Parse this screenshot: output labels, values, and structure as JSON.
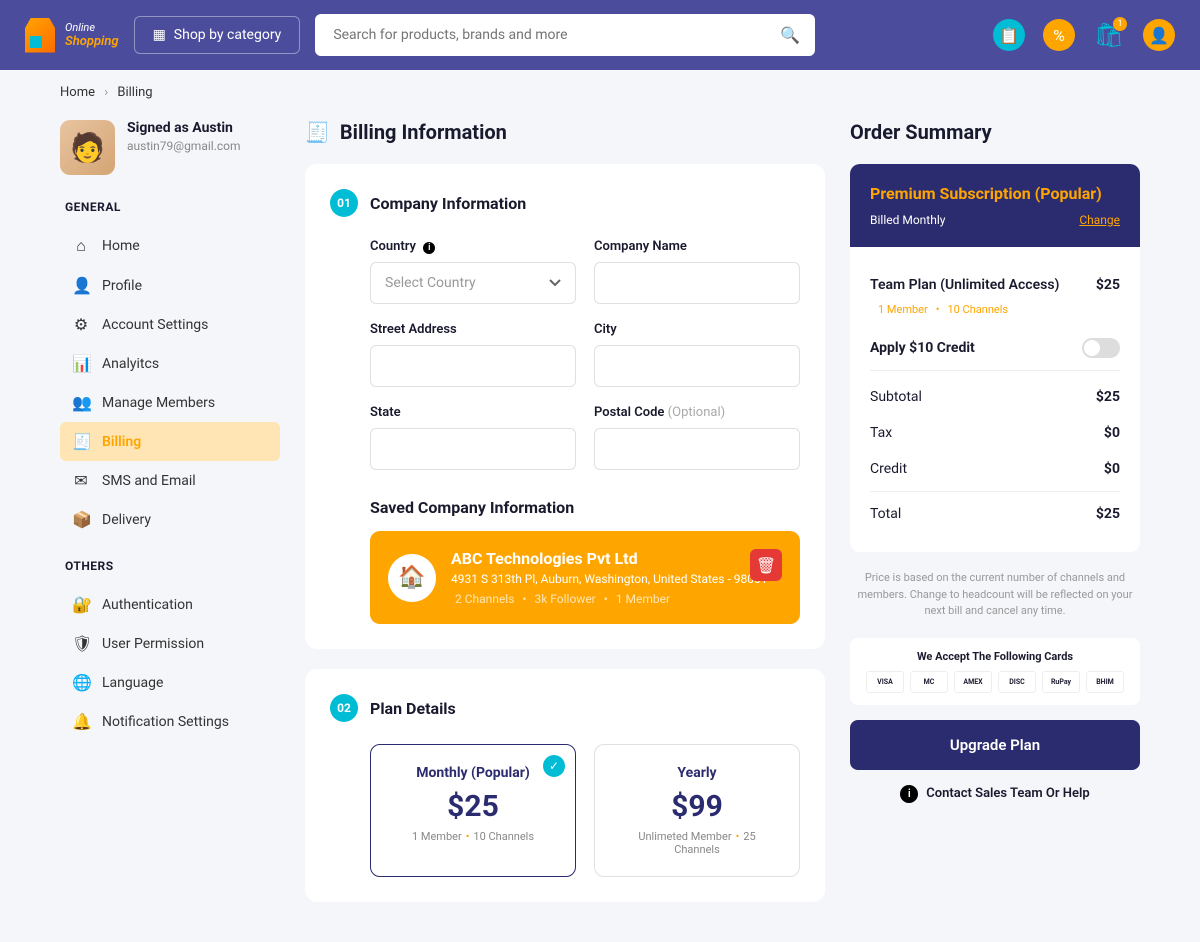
{
  "header": {
    "logo_line1": "Online",
    "logo_line2": "Shopping",
    "category_btn": "Shop by category",
    "search_placeholder": "Search for products, brands and more",
    "cart_badge": "1"
  },
  "breadcrumb": {
    "home": "Home",
    "current": "Billing"
  },
  "user": {
    "signed_as": "Signed as Austin",
    "email": "austin79@gmail.com"
  },
  "sidebar": {
    "groups": [
      {
        "title": "GENERAL",
        "items": [
          {
            "label": "Home",
            "icon": "⌂"
          },
          {
            "label": "Profile",
            "icon": "👤"
          },
          {
            "label": "Account Settings",
            "icon": "⚙"
          },
          {
            "label": "Analyitcs",
            "icon": "📊"
          },
          {
            "label": "Manage Members",
            "icon": "👥"
          },
          {
            "label": "Billing",
            "icon": "🧾",
            "active": true
          },
          {
            "label": "SMS and Email",
            "icon": "✉"
          },
          {
            "label": "Delivery",
            "icon": "📦"
          }
        ]
      },
      {
        "title": "OTHERS",
        "items": [
          {
            "label": "Authentication",
            "icon": "🔐"
          },
          {
            "label": "User Permission",
            "icon": "🛡"
          },
          {
            "label": "Language",
            "icon": "🌐"
          },
          {
            "label": "Notification Settings",
            "icon": "🔔"
          }
        ]
      }
    ]
  },
  "page": {
    "title": "Billing Information"
  },
  "company_info": {
    "step": "01",
    "title": "Company Information",
    "labels": {
      "country": "Country",
      "company_name": "Company Name",
      "street": "Street Address",
      "city": "City",
      "state": "State",
      "postal": "Postal Code",
      "optional": "(Optional)"
    },
    "country_placeholder": "Select Country",
    "saved_title": "Saved Company Information",
    "saved": {
      "name": "ABC Technologies Pvt Ltd",
      "address": "4931 S 313th Pl, Auburn, Washington, United States - 98001",
      "stat1": "2 Channels",
      "stat2": "3k Follower",
      "stat3": "1 Member"
    }
  },
  "plan_details": {
    "step": "02",
    "title": "Plan Details",
    "plans": [
      {
        "name": "Monthly (Popular)",
        "price": "$25",
        "d1": "1 Member",
        "d2": "10 Channels",
        "selected": true
      },
      {
        "name": "Yearly",
        "price": "$99",
        "d1": "Unlimeted Member",
        "d2": "25 Channels"
      }
    ]
  },
  "summary": {
    "title": "Order Summary",
    "plan_name": "Premium Subscription",
    "popular": "(Popular)",
    "billed": "Billed Monthly",
    "change": "Change",
    "team_plan": "Team Plan (Unlimited Access)",
    "team_price": "$25",
    "member_info": "1 Member",
    "channel_info": "10 Channels",
    "apply_credit": "Apply $10 Credit",
    "subtotal_label": "Subtotal",
    "subtotal": "$25",
    "tax_label": "Tax",
    "tax": "$0",
    "credit_label": "Credit",
    "credit": "$0",
    "total_label": "Total",
    "total": "$25",
    "fine_print": "Price is based on the current number of channels and members. Change to headcount will be reflected on your next bill and cancel any time.",
    "accept_title": "We Accept The Following Cards",
    "cards": [
      "VISA",
      "MC",
      "AMEX",
      "DISC",
      "RuPay",
      "BHIM"
    ],
    "upgrade": "Upgrade Plan",
    "contact": "Contact Sales Team Or Help"
  }
}
